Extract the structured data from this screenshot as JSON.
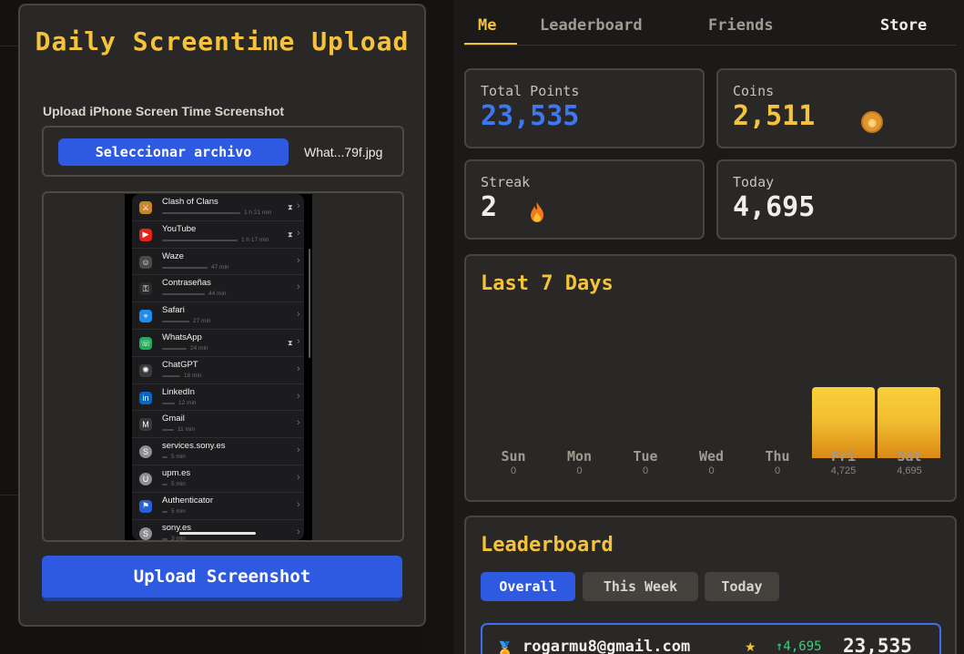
{
  "upload": {
    "title": "Daily Screentime Upload",
    "label": "Upload iPhone Screen Time Screenshot",
    "choose_file": "Seleccionar archivo",
    "file_name": "What...79f.jpg",
    "submit": "Upload Screenshot"
  },
  "screenshot": {
    "apps": [
      {
        "name": "Clash of Clans",
        "time": "1 h 21 min",
        "icon": "clash-of-clans-icon",
        "color": "#c9852b",
        "glyph": "⚔",
        "bar": 0.86,
        "limit": true
      },
      {
        "name": "YouTube",
        "time": "1 h 17 min",
        "icon": "youtube-icon",
        "color": "#e62117",
        "glyph": "▶",
        "bar": 0.83,
        "limit": true
      },
      {
        "name": "Waze",
        "time": "47 min",
        "icon": "waze-icon",
        "color": "#4a4a4a",
        "glyph": "☺",
        "bar": 0.5,
        "limit": false
      },
      {
        "name": "Contraseñas",
        "time": "44 min",
        "icon": "passwords-icon",
        "color": "#2a2a2a",
        "glyph": "⚿",
        "bar": 0.47,
        "limit": false
      },
      {
        "name": "Safari",
        "time": "27 min",
        "icon": "safari-icon",
        "color": "#1e8ef0",
        "glyph": "⌖",
        "bar": 0.3,
        "limit": false
      },
      {
        "name": "WhatsApp",
        "time": "24 min",
        "icon": "whatsapp-icon",
        "color": "#25a95a",
        "glyph": "☏",
        "bar": 0.27,
        "limit": true
      },
      {
        "name": "ChatGPT",
        "time": "18 min",
        "icon": "chatgpt-icon",
        "color": "#3a3a3c",
        "glyph": "✺",
        "bar": 0.2,
        "limit": false
      },
      {
        "name": "LinkedIn",
        "time": "12 min",
        "icon": "linkedin-icon",
        "color": "#0a66c2",
        "glyph": "in",
        "bar": 0.14,
        "limit": false
      },
      {
        "name": "Gmail",
        "time": "11 min",
        "icon": "gmail-icon",
        "color": "#3a3a3c",
        "glyph": "M",
        "bar": 0.13,
        "limit": false
      },
      {
        "name": "services.sony.es",
        "time": "5 min",
        "icon": "website-icon",
        "color": "#8e8e93",
        "glyph": "S",
        "bar": 0.06,
        "limit": false
      },
      {
        "name": "upm.es",
        "time": "5 min",
        "icon": "website-icon",
        "color": "#8e8e93",
        "glyph": "U",
        "bar": 0.06,
        "limit": false
      },
      {
        "name": "Authenticator",
        "time": "5 min",
        "icon": "authenticator-icon",
        "color": "#2560d8",
        "glyph": "⚑",
        "bar": 0.06,
        "limit": false
      },
      {
        "name": "sony.es",
        "time": "3 min",
        "icon": "website-icon",
        "color": "#8e8e93",
        "glyph": "S",
        "bar": 0.04,
        "limit": false
      }
    ]
  },
  "tabs": [
    "Me",
    "Leaderboard",
    "Friends",
    "Store"
  ],
  "active_tab": "Me",
  "stats": {
    "total_points_label": "Total Points",
    "total_points": "23,535",
    "coins_label": "Coins",
    "coins": "2,511",
    "streak_label": "Streak",
    "streak": "2",
    "today_label": "Today",
    "today": "4,695"
  },
  "colors": {
    "accent": "#f5c33b",
    "primary": "#2d5ae0",
    "points_blue": "#3d78f0",
    "positive": "#3ad17a"
  },
  "chart_data": {
    "type": "bar",
    "title": "Last 7 Days",
    "categories": [
      "Sun",
      "Mon",
      "Tue",
      "Wed",
      "Thu",
      "Fri",
      "Sat"
    ],
    "values": [
      0,
      0,
      0,
      0,
      0,
      4725,
      4695
    ],
    "value_labels": [
      "0",
      "0",
      "0",
      "0",
      "0",
      "4,725",
      "4,695"
    ],
    "ylim": [
      0,
      4725
    ],
    "grid": false,
    "legend": "none"
  },
  "leaderboard": {
    "title": "Leaderboard",
    "filters": [
      "Overall",
      "This Week",
      "Today"
    ],
    "active_filter": "Overall",
    "entries": [
      {
        "email": "rogarmu8@gmail.com",
        "gain": "↑4,695",
        "points": "23,535"
      }
    ]
  }
}
